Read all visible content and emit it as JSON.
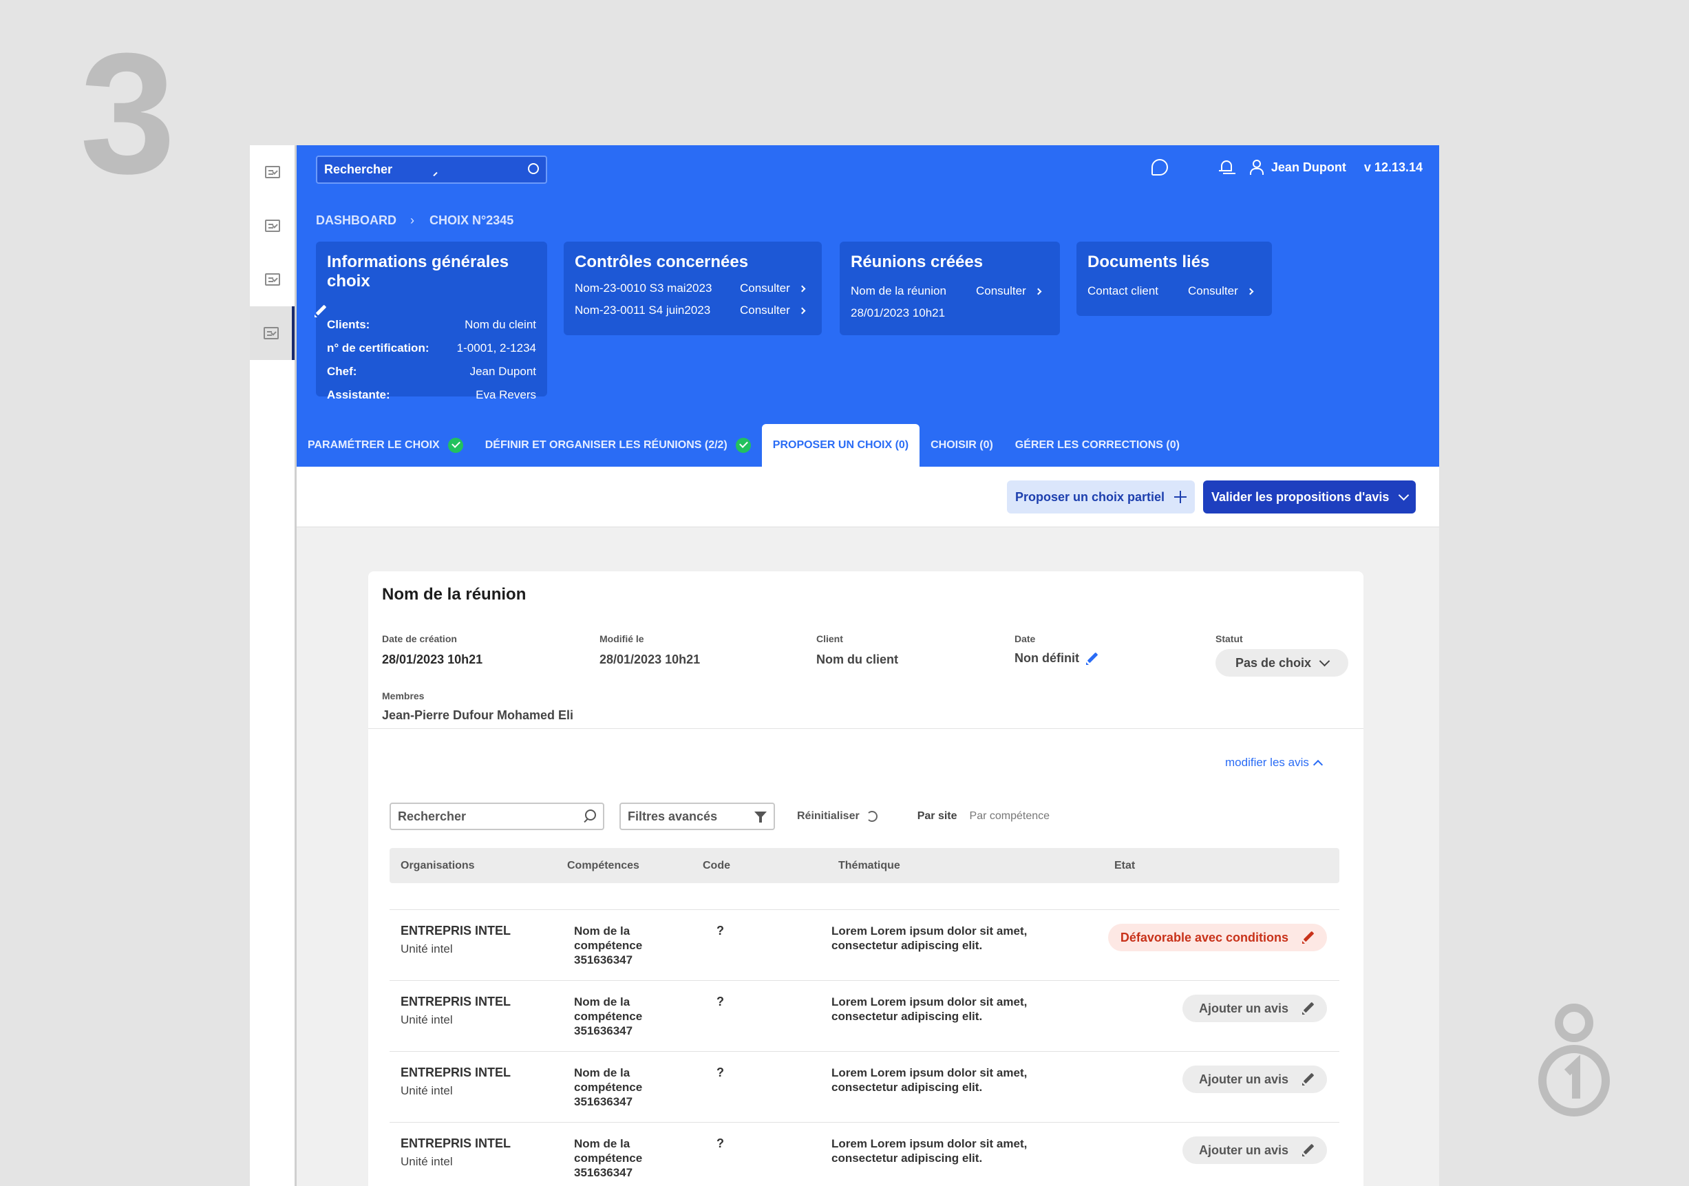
{
  "step_number": "3",
  "colors": {
    "header_blue": "#2a6cf5",
    "card_blue": "#1d58d6",
    "primary_dark": "#1e3fbf",
    "success": "#22c15e",
    "danger": "#c8321a"
  },
  "topbar": {
    "search_placeholder": "Rechercher",
    "user_name": "Jean Dupont",
    "version": "v 12.13.14"
  },
  "breadcrumb": {
    "root": "DASHBOARD",
    "current": "CHOIX N°2345"
  },
  "cards": {
    "info": {
      "title": "Informations générales choix",
      "rows": [
        {
          "label": "Clients:",
          "value": "Nom du cleint"
        },
        {
          "label": "n°  de certification:",
          "value": "1-0001, 2-1234"
        },
        {
          "label": "Chef:",
          "value": "Jean Dupont"
        },
        {
          "label": "Assistante:",
          "value": "Eva Revers"
        }
      ]
    },
    "controls": {
      "title": "Contrôles concernées",
      "items": [
        {
          "name": "Nom-23-0010 S3 mai2023",
          "link": "Consulter"
        },
        {
          "name": "Nom-23-0011 S4  juin2023",
          "link": "Consulter"
        }
      ]
    },
    "meetings": {
      "title": "Réunions créées",
      "name": "Nom de la réunion",
      "link": "Consulter",
      "date": "28/01/2023 10h21"
    },
    "documents": {
      "title": "Documents liés",
      "name": "Contact client",
      "link": "Consulter"
    }
  },
  "tabs": [
    {
      "label": "PARAMÉTRER LE CHOIX",
      "done": true
    },
    {
      "label": "DÉFINIR ET ORGANISER LES RÉUNIONS (2/2)",
      "done": true
    },
    {
      "label": "PROPOSER UN CHOIX (0)",
      "active": true
    },
    {
      "label": "CHOISIR (0)"
    },
    {
      "label": "GÉRER LES CORRECTIONS (0)"
    }
  ],
  "actions": {
    "partial": "Proposer un choix partiel",
    "validate": "Valider les propositions d'avis"
  },
  "meeting": {
    "title": "Nom de la réunion",
    "created_label": "Date de création",
    "created_value": "28/01/2023 10h21",
    "modified_label": "Modifié le",
    "modified_value": "28/01/2023 10h21",
    "client_label": "Client",
    "client_value": "Nom du client",
    "date_label": "Date",
    "date_value": "Non définit",
    "status_label": "Statut",
    "status_value": "Pas de choix",
    "members_label": "Membres",
    "members_value": "Jean-Pierre Dufour  Mohamed Eli",
    "modify_link": "modifier les avis"
  },
  "filters": {
    "search_placeholder": "Rechercher",
    "advanced": "Filtres avancés",
    "reset": "Réinitialiser",
    "by_site": "Par site",
    "by_skill": "Par compétence"
  },
  "table": {
    "headers": {
      "org": "Organisations",
      "skills": "Compétences",
      "code": "Code",
      "theme": "Thématique",
      "state": "Etat"
    },
    "rows": [
      {
        "org": "ENTREPRIS INTEL",
        "unit": "Unité intel",
        "comp1": "Nom de la",
        "comp2": "compétence",
        "comp3": "351636347",
        "code": "?",
        "theme1": "Lorem Lorem ipsum dolor sit amet,",
        "theme2": "consectetur adipiscing elit.",
        "state": "Défavorable avec conditions"
      },
      {
        "org": "ENTREPRIS INTEL",
        "unit": "Unité intel",
        "comp1": "Nom de la",
        "comp2": "compétence",
        "comp3": "351636347",
        "code": "?",
        "theme1": "Lorem Lorem ipsum dolor sit amet,",
        "theme2": "consectetur adipiscing elit.",
        "state": "Ajouter un avis"
      },
      {
        "org": "ENTREPRIS INTEL",
        "unit": "Unité intel",
        "comp1": "Nom de la",
        "comp2": "compétence",
        "comp3": "351636347",
        "code": "?",
        "theme1": "Lorem Lorem ipsum dolor sit amet,",
        "theme2": "consectetur adipiscing elit.",
        "state": "Ajouter un avis"
      },
      {
        "org": "ENTREPRIS INTEL",
        "unit": "Unité intel",
        "comp1": "Nom de la",
        "comp2": "compétence",
        "comp3": "351636347",
        "code": "?",
        "theme1": "Lorem Lorem ipsum dolor sit amet,",
        "theme2": "consectetur adipiscing elit.",
        "state": "Ajouter un avis"
      }
    ]
  }
}
